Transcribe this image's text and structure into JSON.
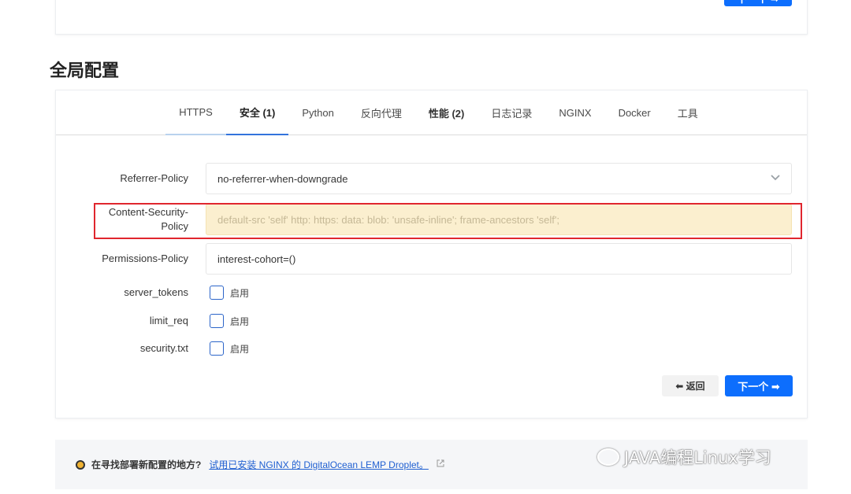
{
  "top_card": {
    "next_label": "下一个 ➡"
  },
  "section_title": "全局配置",
  "tabs": [
    {
      "label": "HTTPS"
    },
    {
      "label": "安全 (1)"
    },
    {
      "label": "Python"
    },
    {
      "label": "反向代理"
    },
    {
      "label": "性能 (2)"
    },
    {
      "label": "日志记录"
    },
    {
      "label": "NGINX"
    },
    {
      "label": "Docker"
    },
    {
      "label": "工具"
    }
  ],
  "form": {
    "referrer_policy": {
      "label": "Referrer-Policy",
      "value": "no-referrer-when-downgrade"
    },
    "csp": {
      "label_line1": "Content-Security-",
      "label_line2": "Policy",
      "placeholder": "default-src 'self' http: https: data: blob: 'unsafe-inline'; frame-ancestors 'self';"
    },
    "permissions_policy": {
      "label": "Permissions-Policy",
      "value": "interest-cohort=()"
    },
    "server_tokens": {
      "label": "server_tokens",
      "option": "启用",
      "checked": false
    },
    "limit_req": {
      "label": "limit_req",
      "option": "启用",
      "checked": false
    },
    "security_txt": {
      "label": "security.txt",
      "option": "启用",
      "checked": false
    }
  },
  "nav": {
    "back_label": "⬅ 返回",
    "next_label": "下一个 ➡"
  },
  "footer": {
    "question": "在寻找部署新配置的地方?",
    "link_text": "试用已安装 NGINX 的 DigitalOcean LEMP Droplet。"
  },
  "watermark": "JAVA编程Linux学习",
  "colors": {
    "primary": "#0d6efd",
    "highlight_border": "#e0262e",
    "csp_bg": "#fbefcf"
  }
}
